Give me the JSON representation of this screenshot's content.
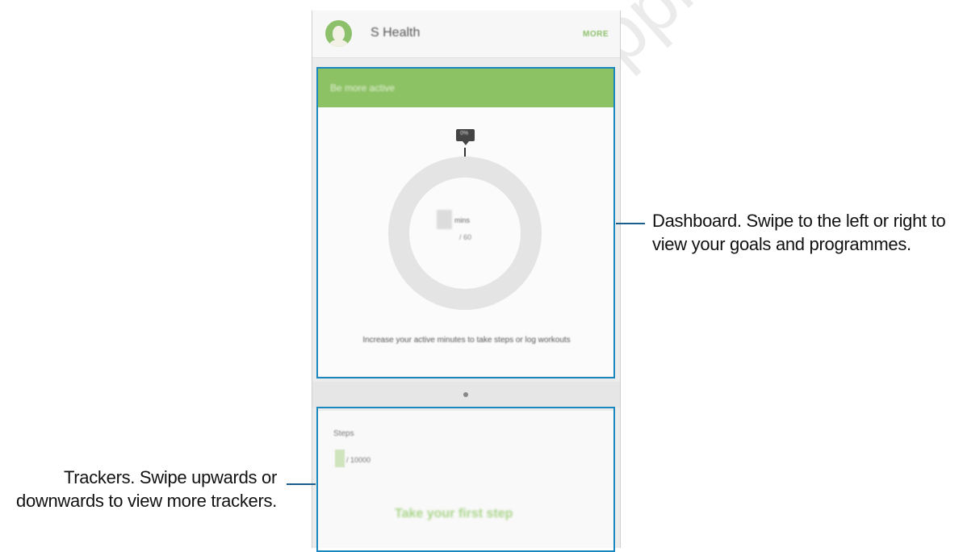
{
  "app": {
    "title": "S Health",
    "more_label": "MORE"
  },
  "dashboard": {
    "header": "Be more active",
    "tooltip": "0%",
    "unit": "mins",
    "goal": "/ 60",
    "message": "Increase your active minutes to take steps or log workouts"
  },
  "tracker": {
    "label": "Steps",
    "goal": "/ 10000",
    "cta": "Take your first step"
  },
  "callouts": {
    "dashboard": "Dashboard. Swipe to the left or right to view your goals and programmes.",
    "trackers": "Trackers. Swipe upwards or downwards to view more trackers."
  },
  "watermark": "Final, Approval Only",
  "colors": {
    "accent_green": "#8cc164",
    "highlight_frame": "#1a87bf",
    "callout_line": "#1a5f8c"
  }
}
